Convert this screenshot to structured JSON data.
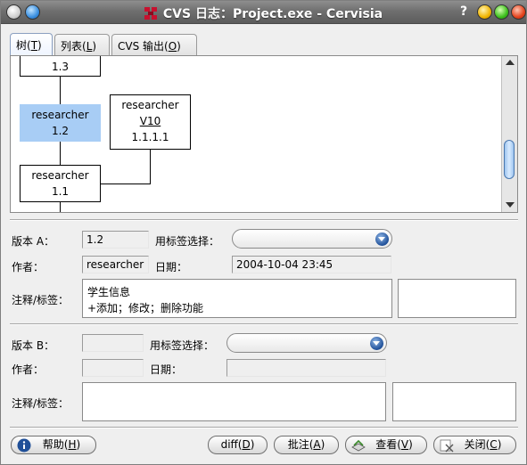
{
  "window": {
    "title": "CVS 日志：Project.exe - Cervisia",
    "help_glyph": "?"
  },
  "tabs": [
    {
      "label": "树(",
      "key": "T",
      "tail": ")"
    },
    {
      "label": "列表(",
      "key": "L",
      "tail": ")"
    },
    {
      "label": "CVS 输出(",
      "key": "O",
      "tail": ")"
    }
  ],
  "tree": {
    "nodes": [
      {
        "author": "",
        "rev": "1.3"
      },
      {
        "author": "researcher",
        "rev": "1.2",
        "selected": true
      },
      {
        "author": "researcher",
        "tag": "V10",
        "rev": "1.1.1.1"
      },
      {
        "author": "researcher",
        "rev": "1.1"
      }
    ]
  },
  "revA": {
    "version_label": "版本 A：",
    "version_value": "1.2",
    "tag_select_label": "用标签选择：",
    "author_label": "作者：",
    "author_value": "researcher",
    "date_label": "日期：",
    "date_value": "2004-10-04 23:45",
    "comment_label": "注释/标签：",
    "comment_lines": [
      "学生信息",
      "+添加；修改；删除功能"
    ]
  },
  "revB": {
    "version_label": "版本 B：",
    "version_value": "",
    "tag_select_label": "用标签选择：",
    "author_label": "作者：",
    "author_value": "",
    "date_label": "日期：",
    "date_value": "",
    "comment_label": "注释/标签："
  },
  "buttons": {
    "help": {
      "label": "帮助(",
      "key": "H",
      "tail": ")"
    },
    "diff": {
      "label": "diff(",
      "key": "D",
      "tail": ")"
    },
    "annotate": {
      "label": "批注(",
      "key": "A",
      "tail": ")"
    },
    "view": {
      "label": "查看(",
      "key": "V",
      "tail": ")"
    },
    "close": {
      "label": "关闭(",
      "key": "C",
      "tail": ")"
    }
  }
}
